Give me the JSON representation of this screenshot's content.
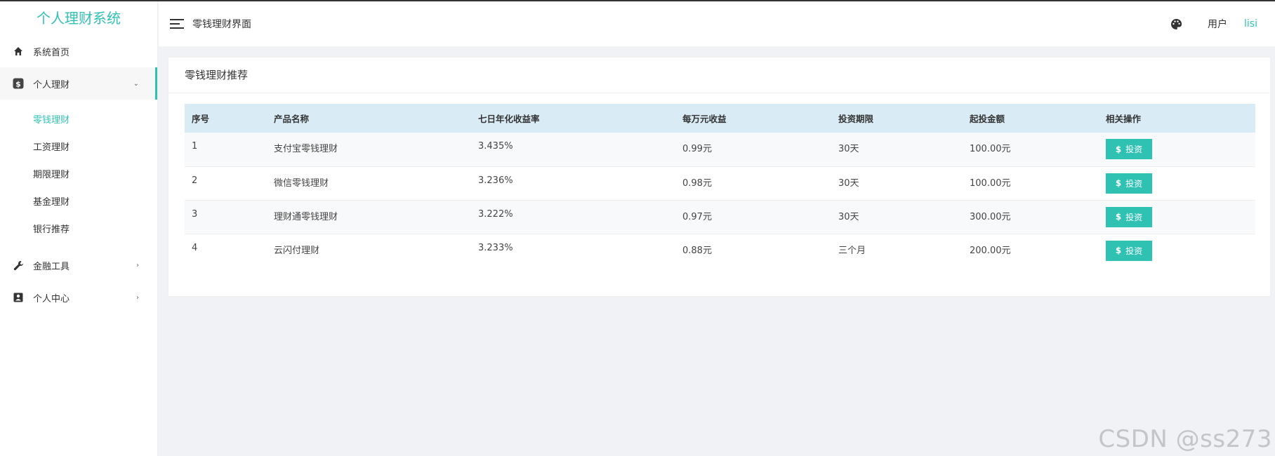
{
  "brand": "个人理财系统",
  "sidebar": {
    "items": [
      {
        "label": "系统首页",
        "icon": "home-icon"
      },
      {
        "label": "个人理财",
        "icon": "dollar-icon"
      },
      {
        "label": "金融工具",
        "icon": "wrench-icon"
      },
      {
        "label": "个人中心",
        "icon": "contact-card-icon"
      }
    ],
    "submenu": [
      "零钱理财",
      "工资理财",
      "期限理财",
      "基金理财",
      "银行推荐"
    ],
    "active_sub": "零钱理财"
  },
  "header": {
    "title": "零钱理财界面",
    "user_label": "用户",
    "user_name": "lisi",
    "palette_icon": "palette-icon"
  },
  "card": {
    "title": "零钱理财推荐"
  },
  "table": {
    "columns": [
      "序号",
      "产品名称",
      "七日年化收益率",
      "每万元收益",
      "投资期限",
      "起投金额",
      "相关操作"
    ],
    "rows": [
      {
        "no": "1",
        "name": "支付宝零钱理财",
        "rate": "3.435%",
        "per_wan": "0.99元",
        "term": "30天",
        "min": "100.00元",
        "action": "投资"
      },
      {
        "no": "2",
        "name": "微信零钱理财",
        "rate": "3.236%",
        "per_wan": "0.98元",
        "term": "30天",
        "min": "100.00元",
        "action": "投资"
      },
      {
        "no": "3",
        "name": "理财通零钱理财",
        "rate": "3.222%",
        "per_wan": "0.97元",
        "term": "30天",
        "min": "300.00元",
        "action": "投资"
      },
      {
        "no": "4",
        "name": "云闪付理财",
        "rate": "3.233%",
        "per_wan": "0.88元",
        "term": "三个月",
        "min": "200.00元",
        "action": "投资"
      }
    ]
  },
  "watermark": "CSDN @ss273",
  "colors": {
    "accent": "#2fc2b3",
    "table_header": "#d9ecf5"
  }
}
